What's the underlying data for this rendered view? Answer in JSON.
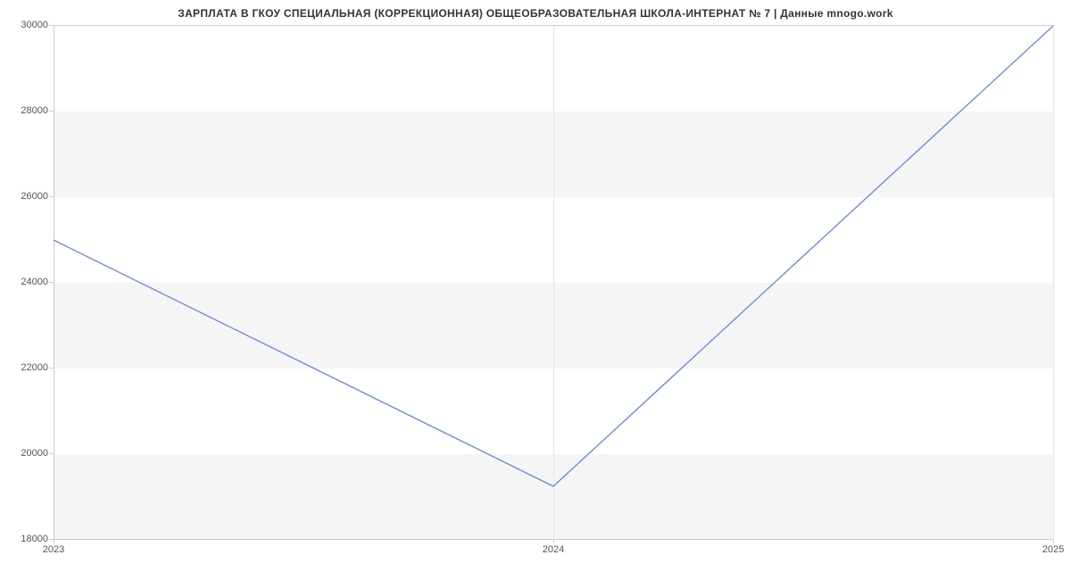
{
  "chart_data": {
    "type": "line",
    "title": "ЗАРПЛАТА В ГКОУ СПЕЦИАЛЬНАЯ (КОРРЕКЦИОННАЯ) ОБЩЕОБРАЗОВАТЕЛЬНАЯ ШКОЛА-ИНТЕРНАТ № 7 | Данные mnogo.work",
    "x": [
      2023,
      2024,
      2025
    ],
    "values": [
      25000,
      19250,
      30000
    ],
    "xlabel": "",
    "ylabel": "",
    "ylim": [
      18000,
      30000
    ],
    "xlim": [
      2023,
      2025
    ],
    "yticks": [
      18000,
      20000,
      22000,
      24000,
      26000,
      28000,
      30000
    ],
    "xticks": [
      2023,
      2024,
      2025
    ],
    "line_color": "#6d8fd6",
    "band_color": "#f5f5f5"
  }
}
